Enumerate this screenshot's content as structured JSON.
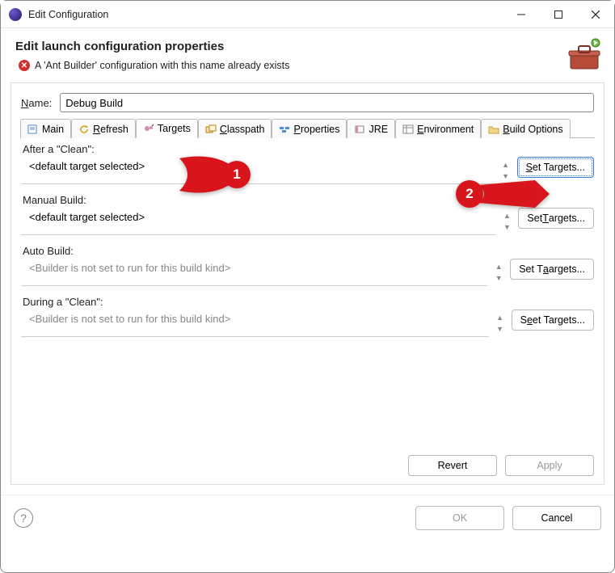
{
  "window": {
    "title": "Edit Configuration"
  },
  "header": {
    "title": "Edit launch configuration properties",
    "error": "A 'Ant Builder' configuration with this name already exists"
  },
  "name": {
    "label": "ame:",
    "value": "Debug Build"
  },
  "tabs": {
    "main": "Main",
    "refresh": "efresh",
    "targets": "Tar",
    "targets2": "ets",
    "classpath": "lasspath",
    "properties": "roperties",
    "jre": "JRE",
    "environment": "nvironment",
    "build_options": "uild Options"
  },
  "sections": {
    "after_clean": {
      "label": "After a \"Clean\":",
      "value": "<default target selected>",
      "btn": "et Targets..."
    },
    "manual": {
      "label": "Manual Build:",
      "value": "<default target selected>",
      "btn": "argets..."
    },
    "auto": {
      "label": "Auto Build:",
      "value": "<Builder is not set to run for this build kind>",
      "btn": "argets..."
    },
    "during_clean": {
      "label": "During a \"Clean\":",
      "value": "<Builder is not set to run for this build kind>",
      "btn": "et Targets..."
    }
  },
  "actions": {
    "revert": "Revert",
    "apply": "Apply",
    "ok": "OK",
    "cancel": "Cancel"
  },
  "annotations": {
    "a1": "1",
    "a2": "2"
  }
}
